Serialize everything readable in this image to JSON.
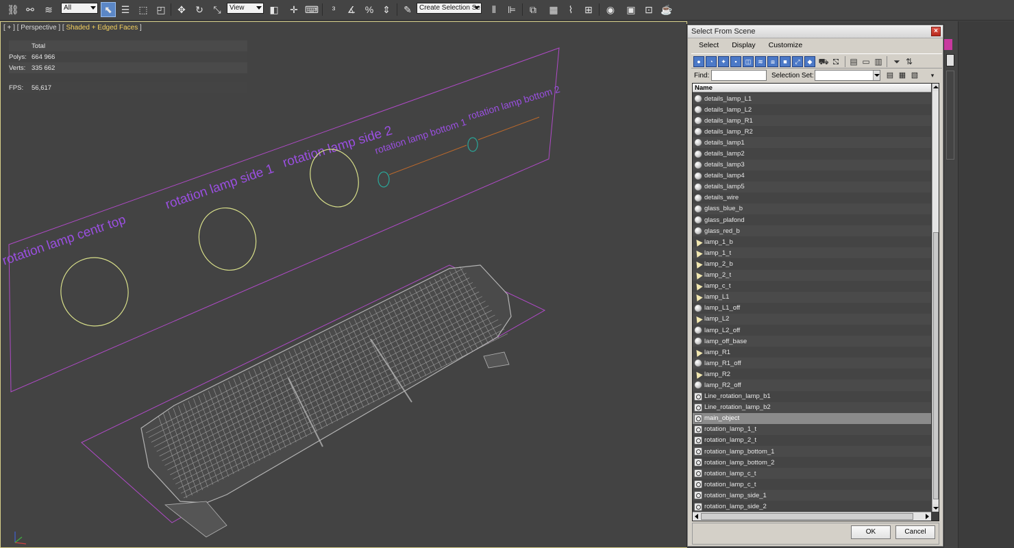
{
  "toolbar": {
    "selection_filter": "All",
    "ref_coord": "View",
    "selection_set_placeholder": "Create Selection Se"
  },
  "viewport": {
    "label_prefix": "[ + ] [ Perspective ] [ ",
    "label_shading": "Shaded + Edged Faces",
    "label_suffix": " ]",
    "stats": {
      "header": "Total",
      "polys_label": "Polys:",
      "polys_value": "664 966",
      "verts_label": "Verts:",
      "verts_value": "335 662",
      "fps_label": "FPS:",
      "fps_value": "56,617"
    },
    "scene_texts": [
      "rotation lamp centr top",
      "rotation lamp side 1",
      "rotation lamp side 2",
      "rotation lamp bottom 1",
      "rotation lamp bottom 2"
    ],
    "colors": {
      "text_shape": "#9a4fe0",
      "circle": "#d9e08a",
      "helper_line": "#c06a2a",
      "helper_circle": "#2aa89a",
      "wire": "#b4b4b4",
      "plane": "#b14ac9"
    }
  },
  "dialog": {
    "title": "Select From Scene",
    "menu": [
      "Select",
      "Display",
      "Customize"
    ],
    "find_label": "Find:",
    "find_value": "",
    "selection_set_label": "Selection Set:",
    "column_name": "Name",
    "ok_label": "OK",
    "cancel_label": "Cancel",
    "items": [
      {
        "name": "details_lamp_L1",
        "type": "geometry"
      },
      {
        "name": "details_lamp_L2",
        "type": "geometry"
      },
      {
        "name": "details_lamp_R1",
        "type": "geometry"
      },
      {
        "name": "details_lamp_R2",
        "type": "geometry"
      },
      {
        "name": "details_lamp1",
        "type": "geometry"
      },
      {
        "name": "details_lamp2",
        "type": "geometry"
      },
      {
        "name": "details_lamp3",
        "type": "geometry"
      },
      {
        "name": "details_lamp4",
        "type": "geometry"
      },
      {
        "name": "details_lamp5",
        "type": "geometry"
      },
      {
        "name": "details_wire",
        "type": "geometry"
      },
      {
        "name": "glass_blue_b",
        "type": "geometry"
      },
      {
        "name": "glass_plafond",
        "type": "geometry"
      },
      {
        "name": "glass_red_b",
        "type": "geometry"
      },
      {
        "name": "lamp_1_b",
        "type": "light"
      },
      {
        "name": "lamp_1_t",
        "type": "light"
      },
      {
        "name": "lamp_2_b",
        "type": "light"
      },
      {
        "name": "lamp_2_t",
        "type": "light"
      },
      {
        "name": "lamp_c_t",
        "type": "light"
      },
      {
        "name": "lamp_L1",
        "type": "light"
      },
      {
        "name": "lamp_L1_off",
        "type": "geometry"
      },
      {
        "name": "lamp_L2",
        "type": "light"
      },
      {
        "name": "lamp_L2_off",
        "type": "geometry"
      },
      {
        "name": "lamp_off_base",
        "type": "geometry"
      },
      {
        "name": "lamp_R1",
        "type": "light"
      },
      {
        "name": "lamp_R1_off",
        "type": "geometry"
      },
      {
        "name": "lamp_R2",
        "type": "light"
      },
      {
        "name": "lamp_R2_off",
        "type": "geometry"
      },
      {
        "name": "Line_rotation_lamp_b1",
        "type": "shape"
      },
      {
        "name": "Line_rotation_lamp_b2",
        "type": "shape"
      },
      {
        "name": "main_object",
        "type": "shape",
        "selected": true
      },
      {
        "name": "rotation_lamp_1_t",
        "type": "shape"
      },
      {
        "name": "rotation_lamp_2_t",
        "type": "shape"
      },
      {
        "name": "rotation_lamp_bottom_1",
        "type": "shape"
      },
      {
        "name": "rotation_lamp_bottom_2",
        "type": "shape"
      },
      {
        "name": "rotation_lamp_c_t",
        "type": "shape"
      },
      {
        "name": "rotation_lamp_c_t",
        "type": "shape"
      },
      {
        "name": "rotation_lamp_side_1",
        "type": "shape"
      },
      {
        "name": "rotation_lamp_side_2",
        "type": "shape"
      }
    ]
  }
}
